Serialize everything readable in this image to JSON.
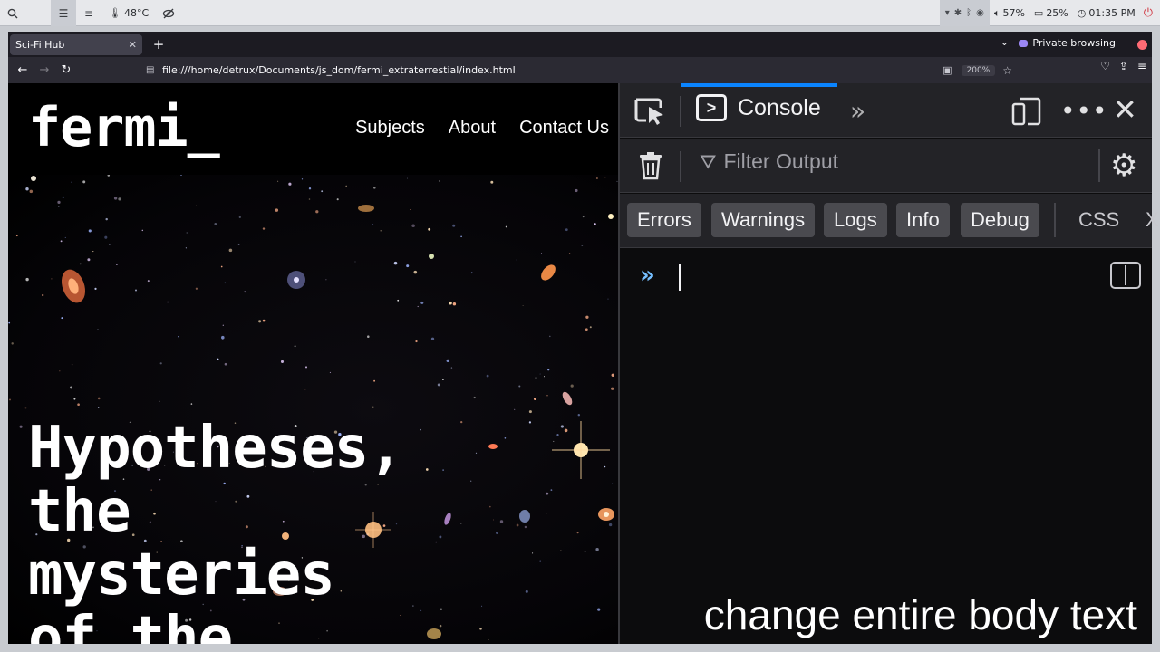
{
  "os_panel": {
    "temperature": "48°C",
    "battery_level": "57%",
    "brightness": "25%",
    "clock": "01:35 PM"
  },
  "browser": {
    "tab_title": "Sci-Fi Hub",
    "new_tab_symbol": "+",
    "private_label": "Private browsing",
    "url": "file:///home/detrux/Documents/js_dom/fermi_extraterrestial/index.html",
    "zoom": "200%"
  },
  "site": {
    "logo": "fermi_",
    "nav": [
      "Subjects",
      "About",
      "Contact Us"
    ],
    "hero_lines": [
      "Hypotheses,",
      "the",
      "mysteries",
      "of the"
    ]
  },
  "devtools": {
    "active_tab": "Console",
    "filter_placeholder": "Filter Output",
    "levels": [
      "Errors",
      "Warnings",
      "Logs",
      "Info",
      "Debug"
    ],
    "extra_filters": [
      "CSS",
      "X"
    ]
  },
  "caption": "change entire body text",
  "colors": {
    "accent": "#0a84ff",
    "prompt": "#75bfff",
    "recording": "#ff6b75"
  }
}
